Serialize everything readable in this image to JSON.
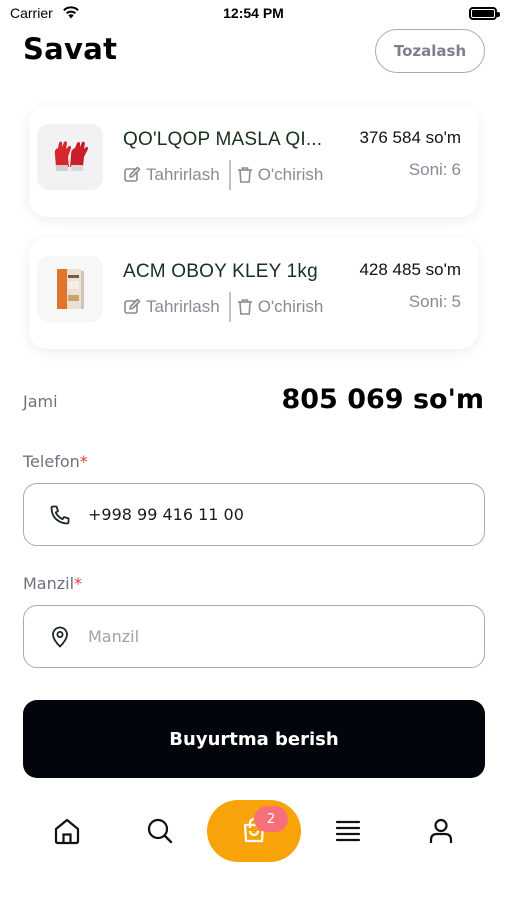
{
  "status_bar": {
    "carrier": "Carrier",
    "time": "12:54 PM"
  },
  "header": {
    "title": "Savat",
    "clear_label": "Tozalash"
  },
  "cart_items": [
    {
      "name": "QO'LQOP MASLA QI...",
      "price": "376 584 so'm",
      "edit_label": "Tahrirlash",
      "delete_label": "O'chirish",
      "qty_label": "Soni:",
      "qty": "6",
      "image": "red-gloves"
    },
    {
      "name": "ACM OBOY KLEY 1kg",
      "price": "428 485 so'm",
      "edit_label": "Tahrirlash",
      "delete_label": "O'chirish",
      "qty_label": "Soni:",
      "qty": "5",
      "image": "glue-package"
    }
  ],
  "total": {
    "label": "Jami",
    "value": "805 069 so'm"
  },
  "phone": {
    "label": "Telefon",
    "required_mark": "*",
    "value": "+998 99 416 11 00",
    "icon": "phone-icon"
  },
  "address": {
    "label": "Manzil",
    "required_mark": "*",
    "placeholder": "Manzil",
    "value": "",
    "icon": "location-pin-icon"
  },
  "order_button": {
    "label": "Buyurtma berish"
  },
  "tab_bar": {
    "tabs": [
      "home-icon",
      "search-icon",
      "cart-icon",
      "menu-icon",
      "profile-icon"
    ],
    "cart_badge": "2",
    "active_color": "#f9a30b"
  }
}
